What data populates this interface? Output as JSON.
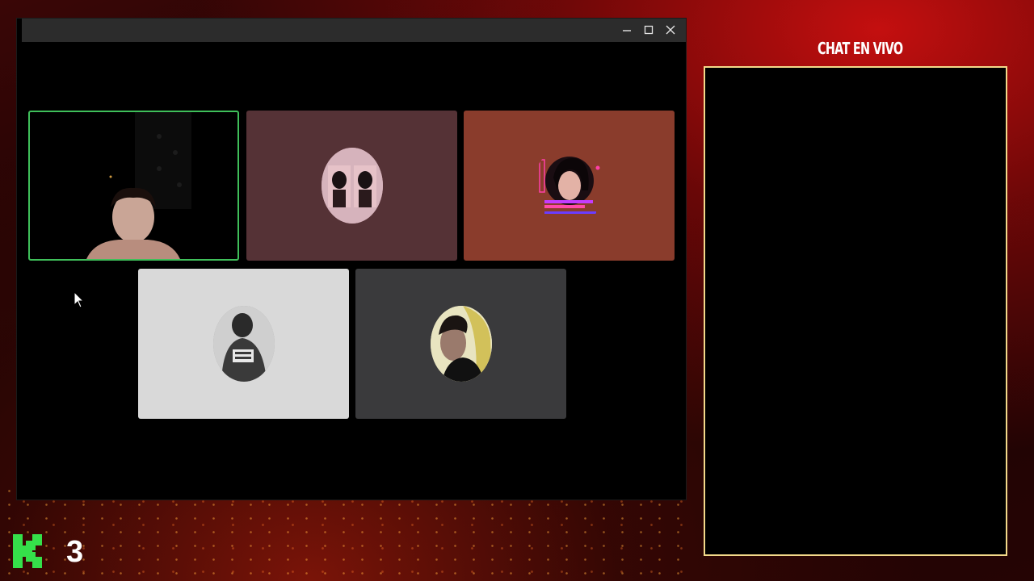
{
  "window": {
    "minimize_icon": "minimize-icon",
    "maximize_icon": "maximize-icon",
    "close_icon": "close-icon"
  },
  "call": {
    "participants": [
      {
        "tile_color": "#000000",
        "active_speaker": true,
        "highlight_color": "#3fbf5a"
      },
      {
        "tile_color": "#553236"
      },
      {
        "tile_color": "#8a3c2c"
      },
      {
        "tile_color": "#d9d9d9"
      },
      {
        "tile_color": "#3a3a3c"
      }
    ]
  },
  "chat": {
    "title": "CHAT EN VIVO",
    "border_color": "#f3d98a"
  },
  "brand": {
    "logo_letter_color": "#35e04a",
    "number": "3"
  }
}
